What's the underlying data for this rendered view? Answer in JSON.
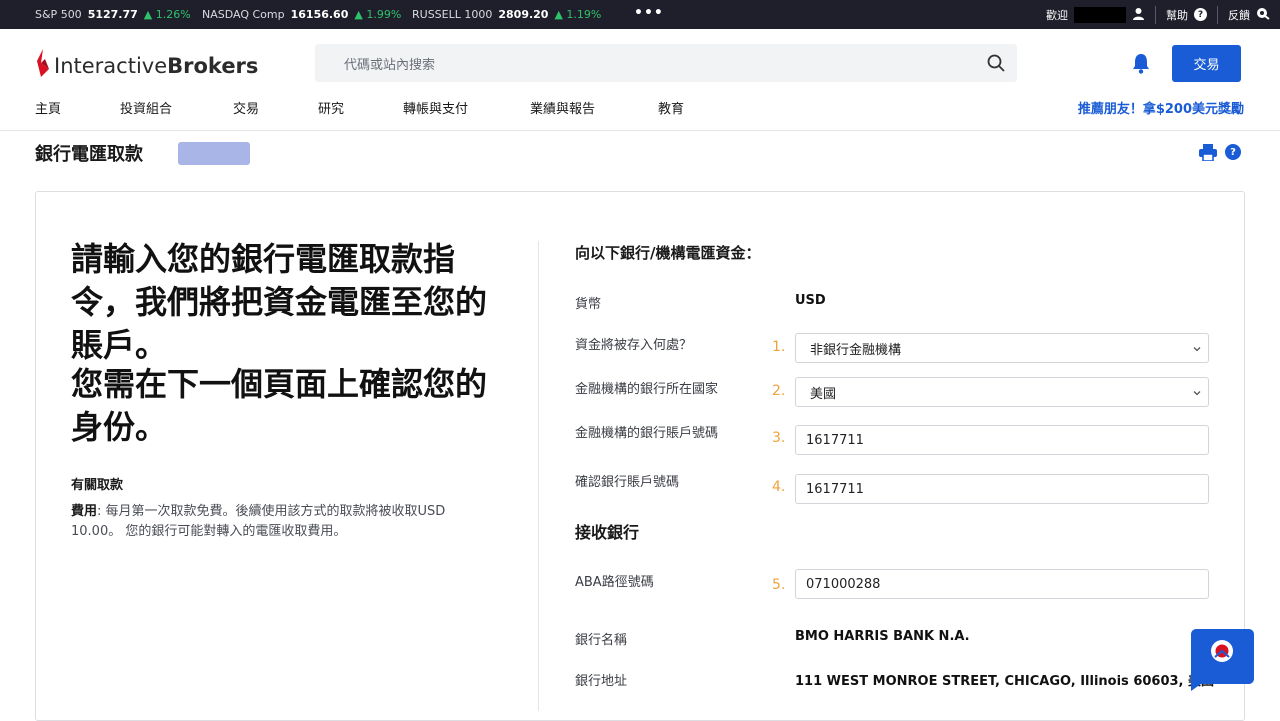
{
  "ticker": {
    "items": [
      {
        "name": "S&P 500",
        "value": "5127.77",
        "change": "▲ 1.26%"
      },
      {
        "name": "NASDAQ Comp",
        "value": "16156.60",
        "change": "▲ 1.99%"
      },
      {
        "name": "RUSSELL 1000",
        "value": "2809.20",
        "change": "▲ 1.19%"
      }
    ],
    "more": "•••",
    "welcome": "歡迎",
    "help": "幫助",
    "feedback": "反饋"
  },
  "header": {
    "logo_regular": "Interactive",
    "logo_bold": "Brokers",
    "search_placeholder": "代碼或站內搜索",
    "trade_button": "交易",
    "nav": [
      "主頁",
      "投資組合",
      "交易",
      "研究",
      "轉帳與支付",
      "業績與報告",
      "教育"
    ],
    "referral": "推薦朋友！拿$200美元獎勵"
  },
  "page": {
    "title": "銀行電匯取款"
  },
  "left": {
    "instruction": "請輸入您的銀行電匯取款指令，我們將把資金電匯至您的賬戶。",
    "confirm": "您需在下一個頁面上確認您的身份。",
    "about_heading": "有關取款",
    "fee_label": "費用",
    "fee_text": ": 每月第一次取款免費。後續使用該方式的取款將被收取USD 10.00。 您的銀行可能對轉入的電匯收取費用。"
  },
  "right": {
    "heading": "向以下銀行/機構電匯資金：",
    "currency_label": "貨幣",
    "currency_value": "USD",
    "deposit_label": "資金將被存入何處？",
    "deposit_value": "非銀行金融機構",
    "country_label": "金融機構的銀行所在國家",
    "country_value": "美國",
    "account_label": "金融機構的銀行賬戶號碼",
    "account_value": "1617711",
    "confirm_account_label": "確認銀行賬戶號碼",
    "confirm_account_value": "1617711",
    "receiving_bank_heading": "接收銀行",
    "aba_label": "ABA路徑號碼",
    "aba_value": "071000288",
    "bank_name_label": "銀行名稱",
    "bank_name_value": "BMO HARRIS BANK N.A.",
    "bank_address_label": "銀行地址",
    "bank_address_value": "111 WEST MONROE STREET, CHICAGO, Illinois 60603, 美國",
    "step_numbers": [
      "1.",
      "2.",
      "3.",
      "4.",
      "5."
    ]
  },
  "colors": {
    "accent": "#1a5cd6",
    "ticker_bg": "#1e1f2a",
    "step_number": "#f0a23b",
    "positive_change": "#2fc26b"
  },
  "icons": [
    "search-icon",
    "bell-icon",
    "user-icon",
    "help-icon",
    "feedback-icon",
    "print-icon",
    "chevron-down-icon",
    "chat-icon",
    "logo-flame-icon"
  ]
}
